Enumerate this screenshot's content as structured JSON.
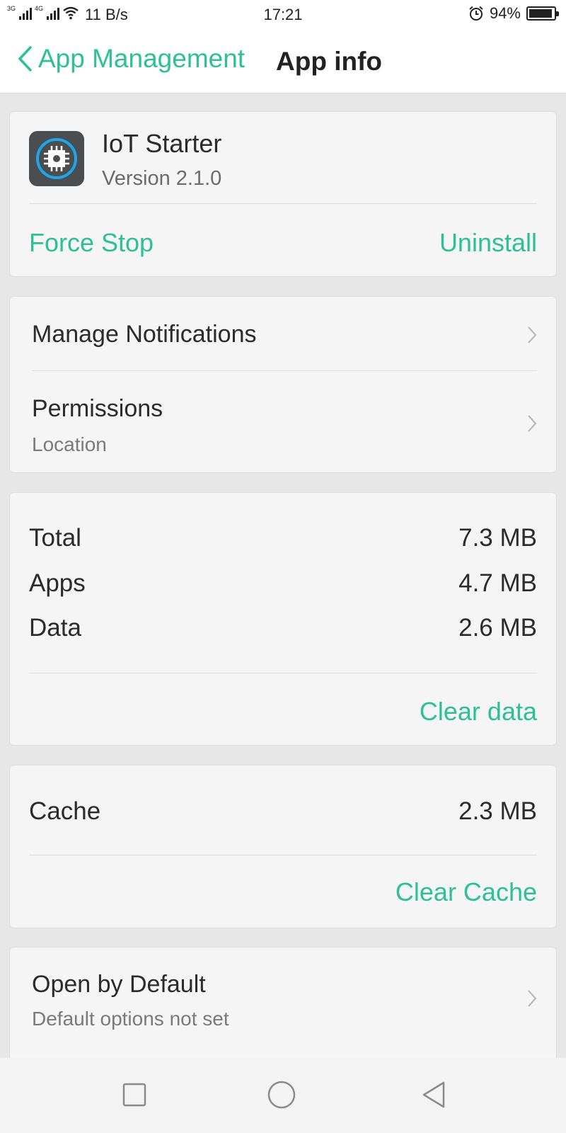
{
  "status_bar": {
    "net1": "3G",
    "net2": "4G",
    "speed": "11 B/s",
    "time": "17:21",
    "battery": "94%",
    "battery_level": 0.94,
    "icons": [
      "signal-icon",
      "wifi-icon",
      "alarm-icon",
      "battery-icon"
    ]
  },
  "header": {
    "back_label": "App Management",
    "title": "App info"
  },
  "app": {
    "name": "IoT Starter",
    "version": "Version 2.1.0",
    "icon": "chip-icon",
    "force_stop": "Force Stop",
    "uninstall": "Uninstall"
  },
  "settings": {
    "notifications": "Manage Notifications",
    "permissions": "Permissions",
    "permissions_sub": "Location"
  },
  "storage": {
    "rows": [
      {
        "label": "Total",
        "value": "7.3 MB"
      },
      {
        "label": "Apps",
        "value": "4.7 MB"
      },
      {
        "label": "Data",
        "value": "2.6 MB"
      }
    ],
    "clear_data": "Clear data"
  },
  "cache": {
    "label": "Cache",
    "value": "2.3 MB",
    "clear_cache": "Clear Cache"
  },
  "defaults": {
    "label": "Open by Default",
    "sub": "Default options not set"
  },
  "colors": {
    "accent": "#2dc095",
    "background": "#e7e7e7",
    "card": "#f5f5f5"
  }
}
